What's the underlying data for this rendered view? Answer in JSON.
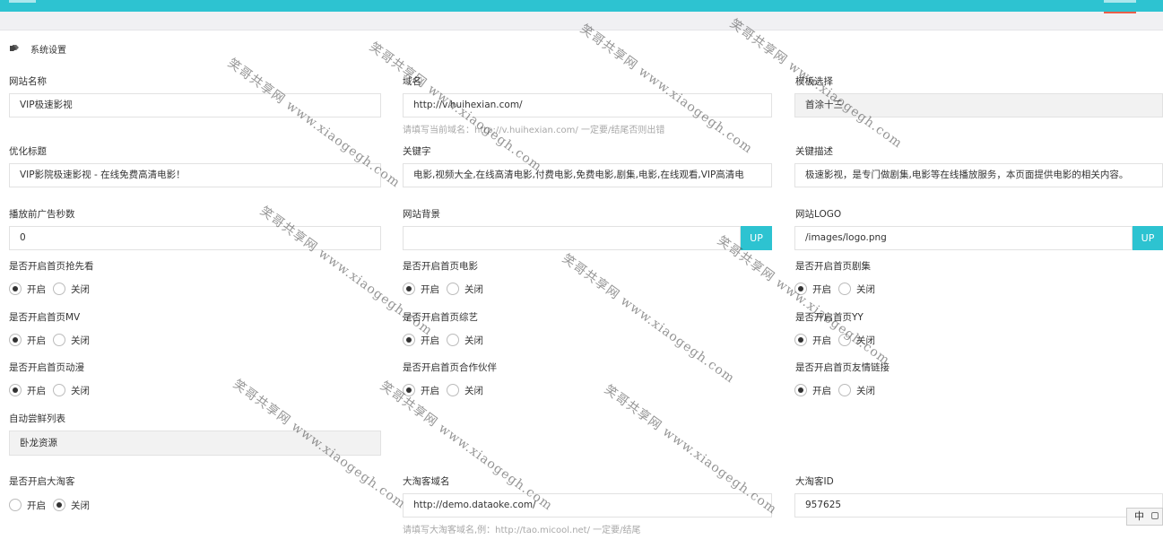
{
  "section": {
    "title": "系统设置"
  },
  "fields": {
    "site_name": {
      "label": "网站名称",
      "value": "VIP极速影视"
    },
    "domain": {
      "label": "域名",
      "value": "http://v.huihexian.com/",
      "hint": "请填写当前域名：http://v.huihexian.com/ 一定要/结尾否则出错"
    },
    "template": {
      "label": "模板选择",
      "value": "首涂十三"
    },
    "seo_title": {
      "label": "优化标题",
      "value": "VIP影院极速影视 - 在线免费高清电影！"
    },
    "keywords": {
      "label": "关键字",
      "value": "电影,视频大全,在线高清电影,付费电影,免费电影,剧集,电影,在线观看,VIP高清电"
    },
    "description": {
      "label": "关键描述",
      "value": "极速影视，是专门做剧集,电影等在线播放服务，本页面提供电影的相关内容。"
    },
    "ad_seconds": {
      "label": "播放前广告秒数",
      "value": "0"
    },
    "background": {
      "label": "网站背景",
      "value": "",
      "button": "UP"
    },
    "logo": {
      "label": "网站LOGO",
      "value": "/images/logo.png",
      "button": "UP"
    },
    "auto_resource": {
      "label": "自动尝鲜列表",
      "value": "卧龙资源"
    },
    "dtk_domain": {
      "label": "大淘客域名",
      "value": "http://demo.dataoke.com/",
      "hint": "请填写大淘客域名,例：http://tao.micool.net/ 一定要/结尾"
    },
    "dtk_id": {
      "label": "大淘客ID",
      "value": "957625"
    }
  },
  "toggles": {
    "home_preview": {
      "label": "是否开启首页抢先看",
      "on": "开启",
      "off": "关闭",
      "selected": "on"
    },
    "home_movie": {
      "label": "是否开启首页电影",
      "on": "开启",
      "off": "关闭",
      "selected": "on"
    },
    "home_series": {
      "label": "是否开启首页剧集",
      "on": "开启",
      "off": "关闭",
      "selected": "on"
    },
    "home_mv": {
      "label": "是否开启首页MV",
      "on": "开启",
      "off": "关闭",
      "selected": "on"
    },
    "home_variety": {
      "label": "是否开启首页综艺",
      "on": "开启",
      "off": "关闭",
      "selected": "on"
    },
    "home_yy": {
      "label": "是否开启首页YY",
      "on": "开启",
      "off": "关闭",
      "selected": "on"
    },
    "home_anime": {
      "label": "是否开启首页动漫",
      "on": "开启",
      "off": "关闭",
      "selected": "on"
    },
    "home_partners": {
      "label": "是否开启首页合作伙伴",
      "on": "开启",
      "off": "关闭",
      "selected": "on"
    },
    "home_links": {
      "label": "是否开启首页友情链接",
      "on": "开启",
      "off": "关闭",
      "selected": "on"
    },
    "dataoke": {
      "label": "是否开启大淘客",
      "on": "开启",
      "off": "关闭",
      "selected": "off"
    }
  },
  "watermark": {
    "text": "笑哥共享网 www.xiaogegh.com"
  },
  "ime": {
    "label": "中"
  },
  "colors": {
    "accent": "#2dc3d1",
    "tab_underline": "#e95f4a"
  }
}
